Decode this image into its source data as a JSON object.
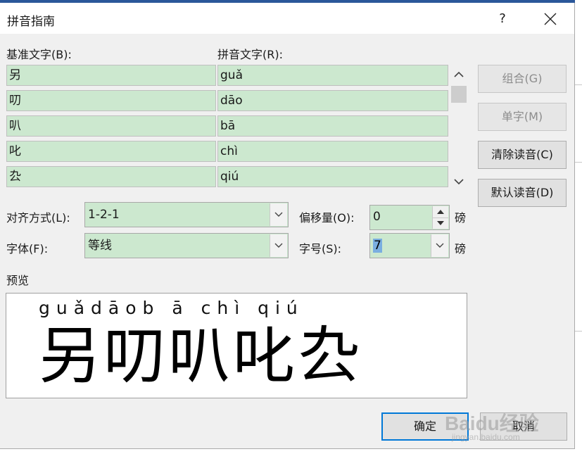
{
  "dialog": {
    "title": "拼音指南",
    "help_label": "?"
  },
  "labels": {
    "base_text": "基准文字(B):",
    "ruby_text": "拼音文字(R):",
    "alignment": "对齐方式(L):",
    "font": "字体(F):",
    "offset": "偏移量(O):",
    "size": "字号(S):",
    "offset_unit": "磅",
    "size_unit": "磅",
    "preview": "预览"
  },
  "rows": [
    {
      "base": "另",
      "ruby": "guǎ"
    },
    {
      "base": "叨",
      "ruby": "dāo"
    },
    {
      "base": "叭",
      "ruby": "bā"
    },
    {
      "base": "叱",
      "ruby": "chì"
    },
    {
      "base": "厹",
      "ruby": "qiú"
    }
  ],
  "buttons": {
    "group": "组合(G)",
    "single": "单字(M)",
    "clear": "清除读音(C)",
    "default": "默认读音(D)",
    "ok": "确定",
    "cancel": "取消"
  },
  "fields": {
    "alignment_value": "1-2-1",
    "font_value": "等线",
    "offset_value": "0",
    "size_value": "7"
  },
  "preview": {
    "ruby": "guǎdāob ā chì qiú",
    "base": "另叨叭叱厹"
  },
  "watermark": {
    "main": "Baidu经验",
    "sub": "jingyan.baidu.com"
  },
  "colors": {
    "field_bg": "#cce8cf",
    "accent": "#0078d7",
    "selection": "#7aaee0"
  }
}
